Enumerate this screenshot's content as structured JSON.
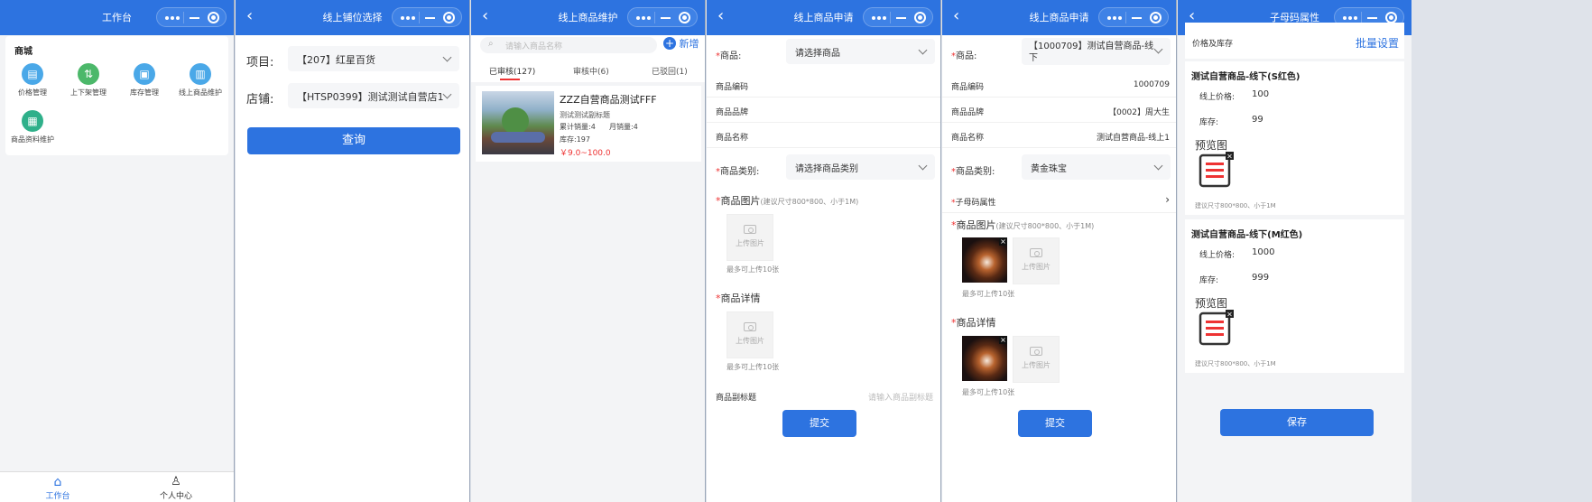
{
  "panel1": {
    "title": "工作台",
    "section": "商城",
    "items": [
      {
        "label": "价格管理",
        "icon": "price-icon"
      },
      {
        "label": "上下架管理",
        "icon": "shelf-icon"
      },
      {
        "label": "库存管理",
        "icon": "inventory-icon"
      },
      {
        "label": "线上商品维护",
        "icon": "product-maintain-icon"
      },
      {
        "label": "商品资料维护",
        "icon": "product-info-icon"
      }
    ],
    "tabs": [
      {
        "label": "工作台"
      },
      {
        "label": "个人中心"
      }
    ]
  },
  "panel2": {
    "title": "线上铺位选择",
    "project_label": "项目:",
    "project_value": "【207】红星百货",
    "store_label": "店铺:",
    "store_value": "【HTSP0399】测试测试自营店1",
    "query_button": "查询"
  },
  "panel3": {
    "title": "线上商品维护",
    "search_placeholder": "请输入商品名称",
    "add_label": "新增",
    "tabs": [
      "已审核(127)",
      "审核中(6)",
      "已驳回(1)"
    ],
    "product": {
      "name": "ZZZ自营商品测试FFF",
      "subtitle": "测试测试副标题",
      "total_sales": "累计销量:4",
      "monthly_sales": "月销量:4",
      "stock": "库存:197",
      "price": "￥9.0~100.0"
    }
  },
  "panel4": {
    "title": "线上商品申请",
    "product_label": "商品:",
    "product_placeholder": "请选择商品",
    "code_label": "商品编码",
    "brand_label": "商品品牌",
    "name_label": "商品名称",
    "category_label": "商品类别:",
    "category_placeholder": "请选择商品类别",
    "image_label": "商品图片",
    "image_hint": "(建议尺寸800*800、小于1M)",
    "upload_text": "上传图片",
    "max_text": "最多可上传10张",
    "detail_label": "商品详情",
    "subtitle_label": "商品副标题",
    "subtitle_placeholder": "请输入商品副标题",
    "submit": "提交"
  },
  "panel5": {
    "title": "线上商品申请",
    "product_label": "商品:",
    "product_value": "【1000709】测试自营商品-线下",
    "code_label": "商品编码",
    "code_value": "1000709",
    "brand_label": "商品品牌",
    "brand_value": "【0002】周大生",
    "name_label": "商品名称",
    "name_value": "测试自营商品-线上1",
    "category_label": "商品类别:",
    "category_value": "黄金珠宝",
    "sku_label": "子母码属性",
    "image_label": "商品图片",
    "image_hint": "(建议尺寸800*800、小于1M)",
    "upload_text": "上传图片",
    "max_text": "最多可上传10张",
    "detail_label": "商品详情",
    "submit": "提交"
  },
  "panel6": {
    "title": "子母码属性",
    "price_stock_label": "价格及库存",
    "batch_label": "批量设置",
    "skus": [
      {
        "name": "测试自营商品-线下(S红色)",
        "price_label": "线上价格:",
        "price": "100",
        "stock_label": "库存:",
        "stock": "99",
        "preview_label": "预览图",
        "hint": "建议尺寸800*800、小于1M"
      },
      {
        "name": "测试自营商品-线下(M红色)",
        "price_label": "线上价格:",
        "price": "1000",
        "stock_label": "库存:",
        "stock": "999",
        "preview_label": "预览图",
        "hint": "建议尺寸800*800、小于1M"
      }
    ],
    "save": "保存"
  },
  "colors": {
    "primary": "#2d73e0",
    "price": "#e33333",
    "required": "#e33333"
  }
}
